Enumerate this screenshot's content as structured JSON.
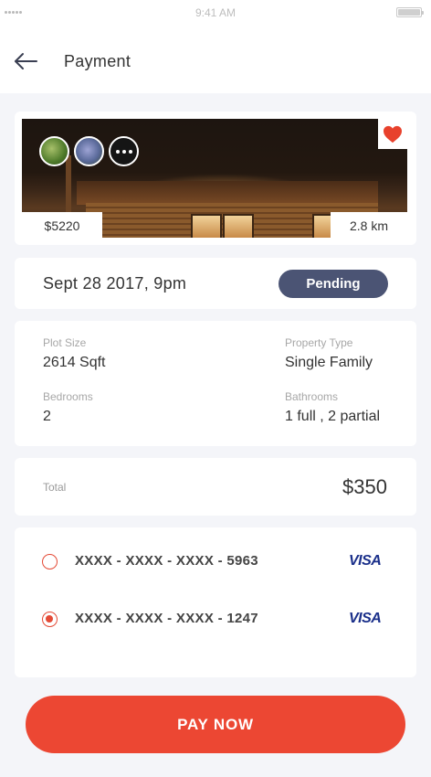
{
  "status_bar": {
    "time": "9:41 AM"
  },
  "header": {
    "title": "Payment",
    "back_icon": "arrow-left-icon"
  },
  "property": {
    "price": "$5220",
    "distance": "2.8 km",
    "favorite_icon": "heart-icon",
    "favorite_color": "#e8412c",
    "more_icon": "more-dots-icon"
  },
  "booking": {
    "date": "Sept 28 2017, 9pm",
    "status": "Pending",
    "status_color": "#4b5474"
  },
  "details": {
    "plot_size": {
      "label": "Plot Size",
      "value": "2614 Sqft"
    },
    "property_type": {
      "label": "Property Type",
      "value": "Single Family"
    },
    "bedrooms": {
      "label": "Bedrooms",
      "value": "2"
    },
    "bathrooms": {
      "label": "Bathrooms",
      "value": "1 full , 2 partial"
    }
  },
  "total": {
    "label": "Total",
    "amount": "$350"
  },
  "payment_methods": [
    {
      "number": "XXXX - XXXX - XXXX - 5963",
      "brand": "VISA",
      "selected": false
    },
    {
      "number": "XXXX - XXXX - XXXX - 1247",
      "brand": "VISA",
      "selected": true
    }
  ],
  "actions": {
    "pay_label": "PAY NOW",
    "accent_color": "#ec4733"
  }
}
